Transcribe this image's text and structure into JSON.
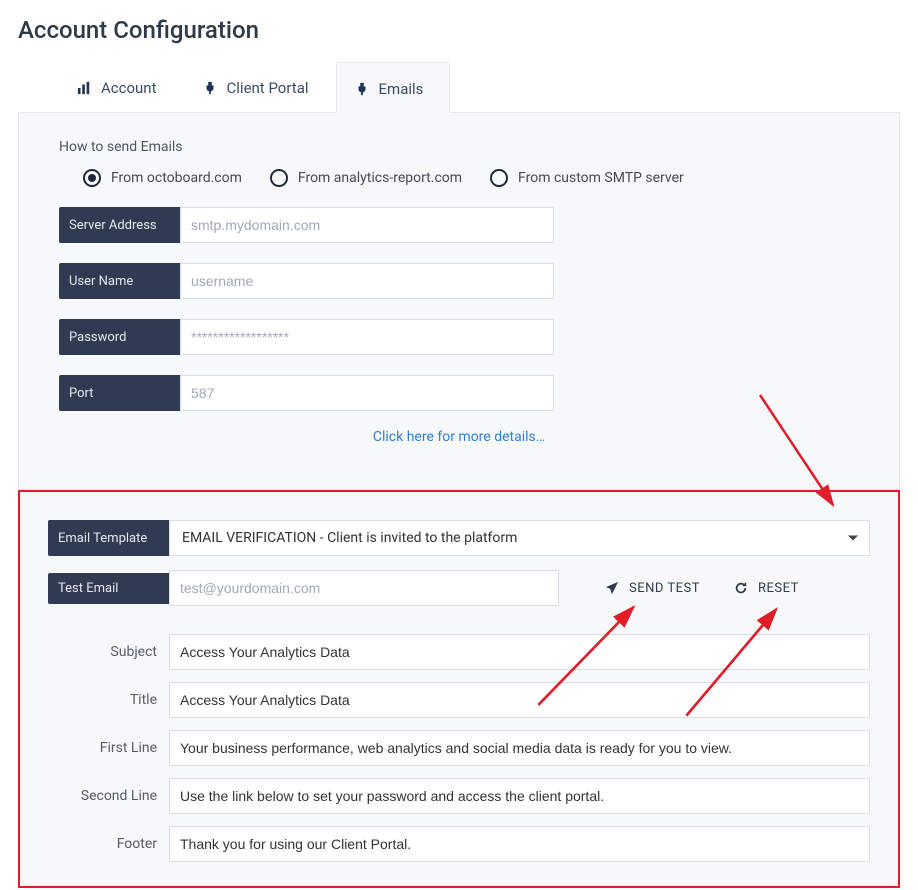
{
  "page": {
    "title": "Account Configuration"
  },
  "tabs": [
    {
      "label": "Account",
      "active": false
    },
    {
      "label": "Client Portal",
      "active": false
    },
    {
      "label": "Emails",
      "active": true
    }
  ],
  "how_to": {
    "title": "How to send Emails",
    "options": [
      {
        "label": "From octoboard.com",
        "selected": true
      },
      {
        "label": "From analytics-report.com",
        "selected": false
      },
      {
        "label": "From custom SMTP server",
        "selected": false
      }
    ]
  },
  "smtp": {
    "server_label": "Server Address",
    "server_placeholder": "smtp.mydomain.com",
    "user_label": "User Name",
    "user_placeholder": "username",
    "password_label": "Password",
    "password_placeholder": "******************",
    "port_label": "Port",
    "port_placeholder": "587"
  },
  "more_link": "Click here for more details…",
  "template": {
    "label": "Email Template",
    "selected": "EMAIL VERIFICATION - Client is invited to the platform"
  },
  "test": {
    "label": "Test Email",
    "placeholder": "test@yourdomain.com",
    "send_label": "SEND TEST",
    "reset_label": "RESET"
  },
  "fields": {
    "subject": {
      "label": "Subject",
      "value": "Access Your Analytics Data"
    },
    "title": {
      "label": "Title",
      "value": "Access Your Analytics Data"
    },
    "first_line": {
      "label": "First Line",
      "value": "Your business performance, web analytics and social media data is ready for you to view."
    },
    "second_line": {
      "label": "Second Line",
      "value": "Use the link below to set your password and access the client portal."
    },
    "footer": {
      "label": "Footer",
      "value": "Thank you for using our Client Portal."
    }
  }
}
